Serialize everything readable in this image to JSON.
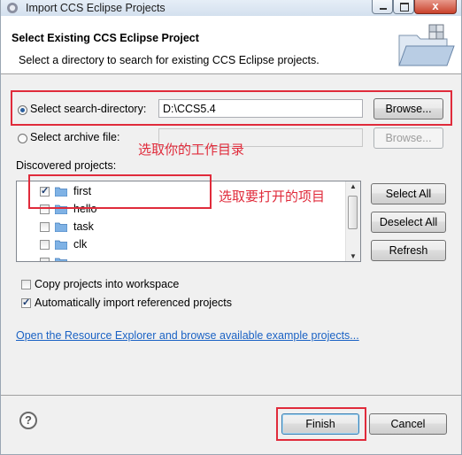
{
  "window": {
    "title": "Import CCS Eclipse Projects",
    "close_glyph": "x"
  },
  "header": {
    "title": "Select Existing CCS Eclipse Project",
    "description": "Select a directory to search for existing CCS Eclipse projects."
  },
  "source": {
    "search_dir_label": "Select search-directory:",
    "search_dir_value": "D:\\CCS5.4",
    "search_dir_selected": true,
    "browse_label": "Browse...",
    "archive_label": "Select archive file:",
    "archive_value": "",
    "archive_browse_label": "Browse..."
  },
  "projects": {
    "label": "Discovered projects:",
    "items": [
      {
        "name": "first",
        "checked": true
      },
      {
        "name": "hello",
        "checked": false
      },
      {
        "name": "task",
        "checked": false
      },
      {
        "name": "clk",
        "checked": false
      },
      {
        "name": "",
        "checked": false
      }
    ],
    "select_all": "Select All",
    "deselect_all": "Deselect All",
    "refresh": "Refresh"
  },
  "options": {
    "copy_into_workspace": {
      "label": "Copy projects into workspace",
      "checked": false
    },
    "auto_import": {
      "label": "Automatically import referenced projects",
      "checked": true
    }
  },
  "resource_link": "Open the Resource Explorer and browse available example projects...",
  "footer": {
    "finish": "Finish",
    "cancel": "Cancel"
  },
  "annotations": {
    "select_dir_note": "选取你的工作目录",
    "select_project_note": "选取要打开的项目"
  },
  "colors": {
    "highlight": "#e02b3b",
    "link": "#1a62c4"
  },
  "icons": [
    "eclipse-app-icon",
    "folder-icon",
    "import-wizard-icon",
    "help-icon"
  ]
}
